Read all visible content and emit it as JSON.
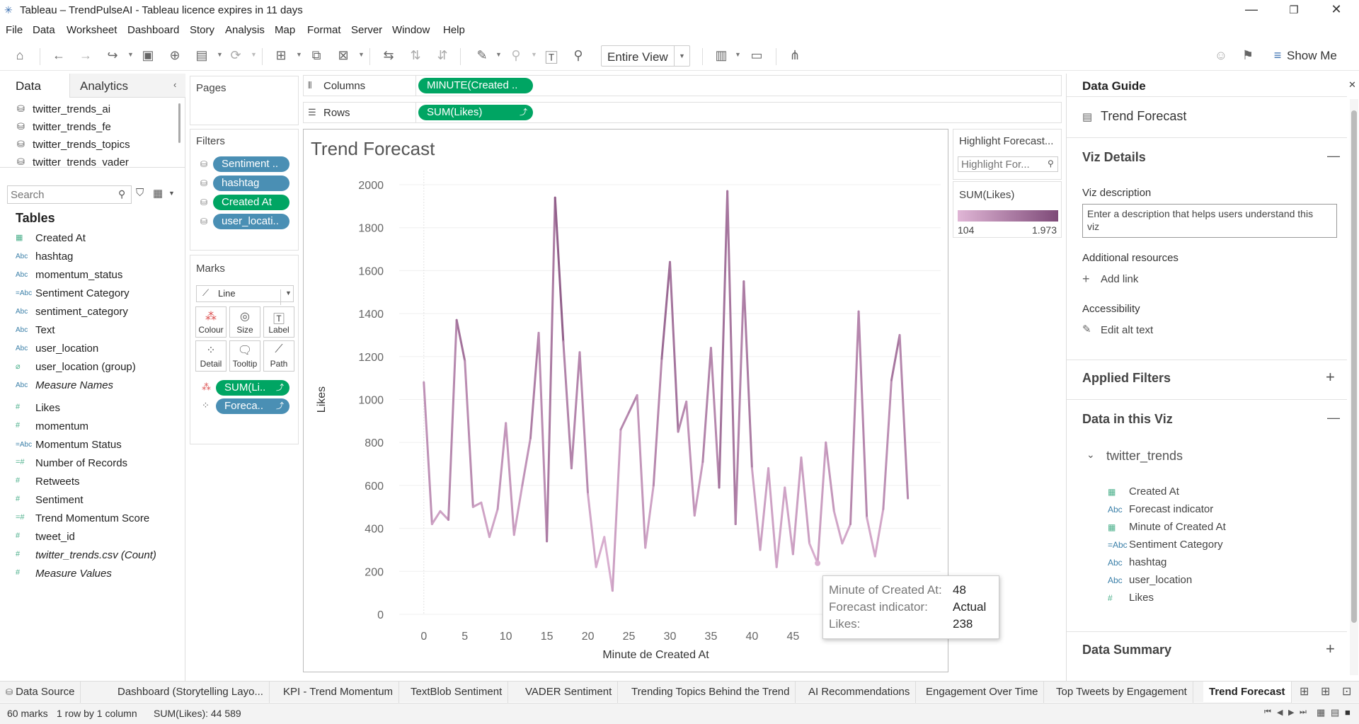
{
  "window": {
    "title": "Tableau – TrendPulseAI - Tableau licence expires in 11 days"
  },
  "menu": [
    "File",
    "Data",
    "Worksheet",
    "Dashboard",
    "Story",
    "Analysis",
    "Map",
    "Format",
    "Server",
    "Window",
    "Help"
  ],
  "toolbar": {
    "view_mode": "Entire View",
    "show_me": "Show Me"
  },
  "left_panel": {
    "tab_data": "Data",
    "tab_analytics": "Analytics",
    "data_sources": [
      "twitter_trends_ai",
      "twitter_trends_fe",
      "twitter_trends_topics",
      "twitter_trends_vader"
    ],
    "search_placeholder": "Search",
    "tables_label": "Tables",
    "fields": [
      {
        "icon": "date",
        "name": "Created At",
        "italic": false
      },
      {
        "icon": "Abc",
        "name": "hashtag",
        "italic": false
      },
      {
        "icon": "Abc",
        "name": "momentum_status",
        "italic": false
      },
      {
        "icon": "=Abc",
        "name": "Sentiment Category",
        "italic": false
      },
      {
        "icon": "Abc",
        "name": "sentiment_category",
        "italic": false
      },
      {
        "icon": "Abc",
        "name": "Text",
        "italic": false
      },
      {
        "icon": "Abc",
        "name": "user_location",
        "italic": false
      },
      {
        "icon": "clip",
        "name": "user_location (group)",
        "italic": false
      },
      {
        "icon": "Abc",
        "name": "Measure Names",
        "italic": true
      },
      {
        "icon": "#",
        "name": "Likes",
        "italic": false
      },
      {
        "icon": "#",
        "name": "momentum",
        "italic": false
      },
      {
        "icon": "=Abc",
        "name": "Momentum Status",
        "italic": false
      },
      {
        "icon": "=#",
        "name": "Number of Records",
        "italic": false
      },
      {
        "icon": "#",
        "name": "Retweets",
        "italic": false
      },
      {
        "icon": "#",
        "name": "Sentiment",
        "italic": false
      },
      {
        "icon": "=#",
        "name": "Trend Momentum Score",
        "italic": false
      },
      {
        "icon": "#",
        "name": "tweet_id",
        "italic": false
      },
      {
        "icon": "#",
        "name": "twitter_trends.csv (Count)",
        "italic": true
      },
      {
        "icon": "#",
        "name": "Measure Values",
        "italic": true
      }
    ]
  },
  "pages_label": "Pages",
  "filters": {
    "label": "Filters",
    "items": [
      {
        "text": "Sentiment ..",
        "color": "blue"
      },
      {
        "text": "hashtag",
        "color": "blue"
      },
      {
        "text": "Created At",
        "color": "green"
      },
      {
        "text": "user_locati..",
        "color": "blue"
      }
    ]
  },
  "marks": {
    "label": "Marks",
    "type": "Line",
    "buttons": [
      "Colour",
      "Size",
      "Label",
      "Detail",
      "Tooltip",
      "Path"
    ],
    "pills": [
      "SUM(Li..",
      "Foreca.."
    ]
  },
  "shelves": {
    "columns_label": "Columns",
    "columns_pill": "MINUTE(Created ..",
    "rows_label": "Rows",
    "rows_pill": "SUM(Likes)"
  },
  "legend": {
    "highlight_title": "Highlight Forecast...",
    "highlight_placeholder": "Highlight For...",
    "color_title": "SUM(Likes)",
    "min": "104",
    "max": "1.973"
  },
  "tooltip": {
    "rows": [
      {
        "key": "Minute of Created At:",
        "value": "48"
      },
      {
        "key": "Forecast indicator:",
        "value": "Actual"
      },
      {
        "key": "Likes:",
        "value": "238"
      }
    ]
  },
  "chart_data": {
    "type": "line",
    "title": "Trend Forecast",
    "xlabel": "Minute de Created At",
    "ylabel": "Likes",
    "xlim": [
      -3,
      63
    ],
    "ylim": [
      0,
      2000
    ],
    "x_ticks": [
      0,
      5,
      10,
      15,
      20,
      25,
      30,
      35,
      40,
      45
    ],
    "y_ticks": [
      0,
      200,
      400,
      600,
      800,
      1000,
      1200,
      1400,
      1600,
      1800,
      2000
    ],
    "x": [
      0,
      1,
      2,
      3,
      4,
      5,
      6,
      7,
      8,
      9,
      10,
      11,
      12,
      13,
      14,
      15,
      16,
      17,
      18,
      19,
      20,
      21,
      22,
      23,
      24,
      25,
      26,
      27,
      28,
      29,
      30,
      31,
      32,
      33,
      34,
      35,
      36,
      37,
      38,
      39,
      40,
      41,
      42,
      43,
      44,
      45,
      46,
      47,
      48,
      49,
      50,
      51,
      52,
      53,
      54,
      55,
      56,
      57,
      58,
      59
    ],
    "values": [
      1080,
      420,
      480,
      440,
      1370,
      1180,
      500,
      520,
      360,
      490,
      890,
      370,
      600,
      820,
      1310,
      340,
      1940,
      1270,
      680,
      1220,
      560,
      220,
      360,
      110,
      860,
      940,
      1020,
      310,
      600,
      1190,
      1640,
      850,
      990,
      460,
      710,
      1240,
      590,
      1970,
      420,
      1550,
      680,
      300,
      680,
      220,
      590,
      280,
      730,
      330,
      238,
      800,
      480,
      330,
      420,
      1410,
      450,
      270,
      490,
      1090,
      1300,
      540
    ],
    "color_range": [
      "#e0b6d6",
      "#7e4a78"
    ]
  },
  "guide": {
    "title": "Data Guide",
    "sheet_name": "Trend Forecast",
    "viz_details": "Viz Details",
    "viz_description_label": "Viz description",
    "viz_description_placeholder": "Enter a description that helps users understand this viz",
    "additional_resources": "Additional resources",
    "add_link": "Add link",
    "accessibility": "Accessibility",
    "edit_alt_text": "Edit alt text",
    "applied_filters": "Applied Filters",
    "data_in_viz": "Data in this Viz",
    "source_name": "twitter_trends",
    "fields": [
      {
        "icon": "date",
        "name": "Created At"
      },
      {
        "icon": "Abc",
        "name": "Forecast indicator"
      },
      {
        "icon": "date",
        "name": "Minute of Created At"
      },
      {
        "icon": "=Abc",
        "name": "Sentiment Category"
      },
      {
        "icon": "Abc",
        "name": "hashtag"
      },
      {
        "icon": "Abc",
        "name": "user_location"
      },
      {
        "icon": "#",
        "name": "Likes"
      }
    ],
    "data_summary": "Data Summary"
  },
  "tabs": [
    {
      "label": "Data Source",
      "active": false
    },
    {
      "label": "Dashboard (Storytelling Layo...",
      "active": false
    },
    {
      "label": "KPI - Trend Momentum",
      "active": false
    },
    {
      "label": "TextBlob Sentiment",
      "active": false
    },
    {
      "label": "VADER Sentiment",
      "active": false
    },
    {
      "label": "Trending Topics Behind the Trend",
      "active": false
    },
    {
      "label": "AI Recommendations",
      "active": false
    },
    {
      "label": "Engagement Over Time",
      "active": false
    },
    {
      "label": "Top Tweets by Engagement",
      "active": false
    },
    {
      "label": "Trend Forecast",
      "active": true
    }
  ],
  "status": {
    "marks": "60 marks",
    "dims": "1 row by 1 column",
    "sum": "SUM(Likes): 44 589"
  }
}
